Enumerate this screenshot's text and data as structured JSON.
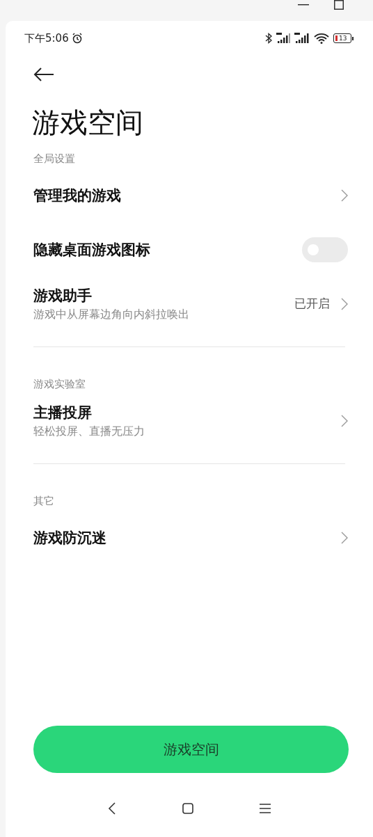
{
  "status_bar": {
    "time": "下午5:06",
    "battery": "13"
  },
  "title": "游戏空间",
  "sections": [
    {
      "header": "全局设置",
      "items": [
        {
          "kind": "link",
          "label": "管理我的游戏"
        },
        {
          "kind": "toggle",
          "label": "隐藏桌面游戏图标",
          "on": false
        },
        {
          "kind": "link",
          "label": "游戏助手",
          "subtitle": "游戏中从屏幕边角向内斜拉唤出",
          "value": "已开启"
        }
      ]
    },
    {
      "header": "游戏实验室",
      "items": [
        {
          "kind": "link",
          "label": "主播投屏",
          "subtitle": "轻松投屏、直播无压力"
        }
      ]
    },
    {
      "header": "其它",
      "items": [
        {
          "kind": "link",
          "label": "游戏防沉迷"
        }
      ]
    }
  ],
  "button": "游戏空间"
}
